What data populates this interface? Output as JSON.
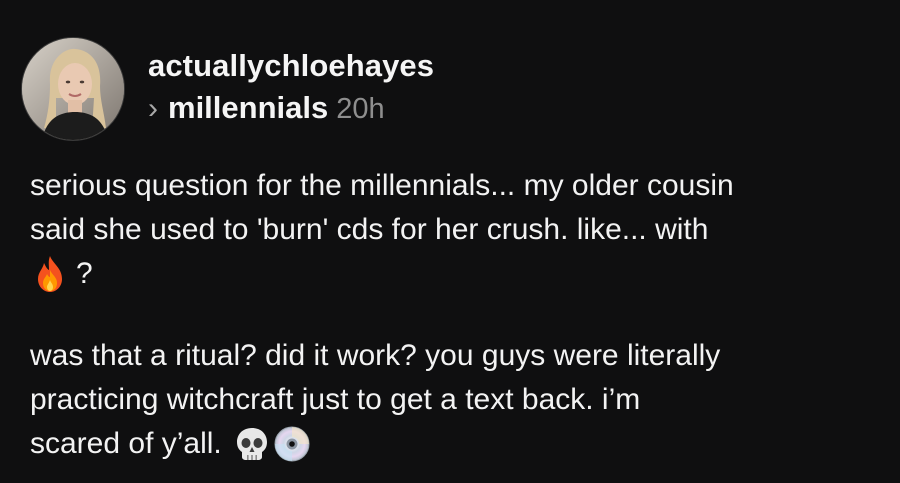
{
  "post": {
    "username": "actuallychloehayes",
    "chevron": "›",
    "community": "millennials",
    "time": "20h",
    "paragraph1": {
      "line1": "serious question for the millennials... my older cousin",
      "line2": "said she used to 'burn' cds for her crush. like... with",
      "line3_after_emoji": "?"
    },
    "paragraph2": {
      "line1": "was that a ritual? did it work? you guys were literally",
      "line2": "practicing witchcraft just to get a text back. i’m",
      "line3": "scared of y’all."
    },
    "emojis": [
      "fire-emoji",
      "skull-emoji",
      "cd-emoji"
    ]
  },
  "colors": {
    "background": "#0f0f10",
    "text": "#f3f3f3",
    "muted": "#8e8e8e"
  }
}
